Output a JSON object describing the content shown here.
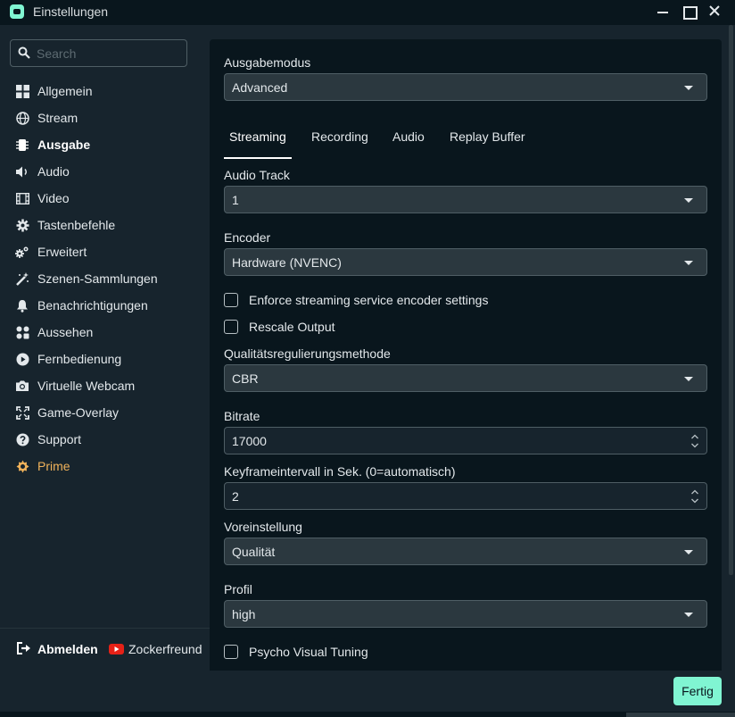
{
  "window": {
    "title": "Einstellungen"
  },
  "search": {
    "placeholder": "Search"
  },
  "sidebar": {
    "items": [
      {
        "label": "Allgemein",
        "icon": "grid-icon"
      },
      {
        "label": "Stream",
        "icon": "globe-icon"
      },
      {
        "label": "Ausgabe",
        "icon": "chip-icon",
        "active": true
      },
      {
        "label": "Audio",
        "icon": "speaker-icon"
      },
      {
        "label": "Video",
        "icon": "film-icon"
      },
      {
        "label": "Tastenbefehle",
        "icon": "gear-icon"
      },
      {
        "label": "Erweitert",
        "icon": "gears-icon"
      },
      {
        "label": "Szenen-Sammlungen",
        "icon": "magic-wand-icon"
      },
      {
        "label": "Benachrichtigungen",
        "icon": "bell-icon"
      },
      {
        "label": "Aussehen",
        "icon": "widgets-icon"
      },
      {
        "label": "Fernbedienung",
        "icon": "play-circle-icon"
      },
      {
        "label": "Virtuelle Webcam",
        "icon": "camera-icon"
      },
      {
        "label": "Game-Overlay",
        "icon": "expand-icon"
      },
      {
        "label": "Support",
        "icon": "question-icon"
      },
      {
        "label": "Prime",
        "icon": "prime-icon"
      }
    ],
    "logout_label": "Abmelden",
    "account_name": "Zockerfreund"
  },
  "main": {
    "output_mode_label": "Ausgabemodus",
    "output_mode_value": "Advanced",
    "tabs": [
      {
        "label": "Streaming",
        "active": true
      },
      {
        "label": "Recording"
      },
      {
        "label": "Audio"
      },
      {
        "label": "Replay Buffer"
      }
    ],
    "audio_track_label": "Audio Track",
    "audio_track_value": "1",
    "encoder_label": "Encoder",
    "encoder_value": "Hardware (NVENC)",
    "enforce_label": "Enforce streaming service encoder settings",
    "rescale_label": "Rescale Output",
    "rate_control_label": "Qualitätsregulierungsmethode",
    "rate_control_value": "CBR",
    "bitrate_label": "Bitrate",
    "bitrate_value": "17000",
    "keyframe_label": "Keyframeintervall in Sek. (0=automatisch)",
    "keyframe_value": "2",
    "preset_label": "Voreinstellung",
    "preset_value": "Qualität",
    "profile_label": "Profil",
    "profile_value": "high",
    "psycho_label": "Psycho Visual Tuning"
  },
  "footer": {
    "done_label": "Fertig"
  },
  "colors": {
    "accent": "#80f5d2",
    "prime": "#f0b25a",
    "background": "#17242d",
    "panel": "#09161d"
  }
}
